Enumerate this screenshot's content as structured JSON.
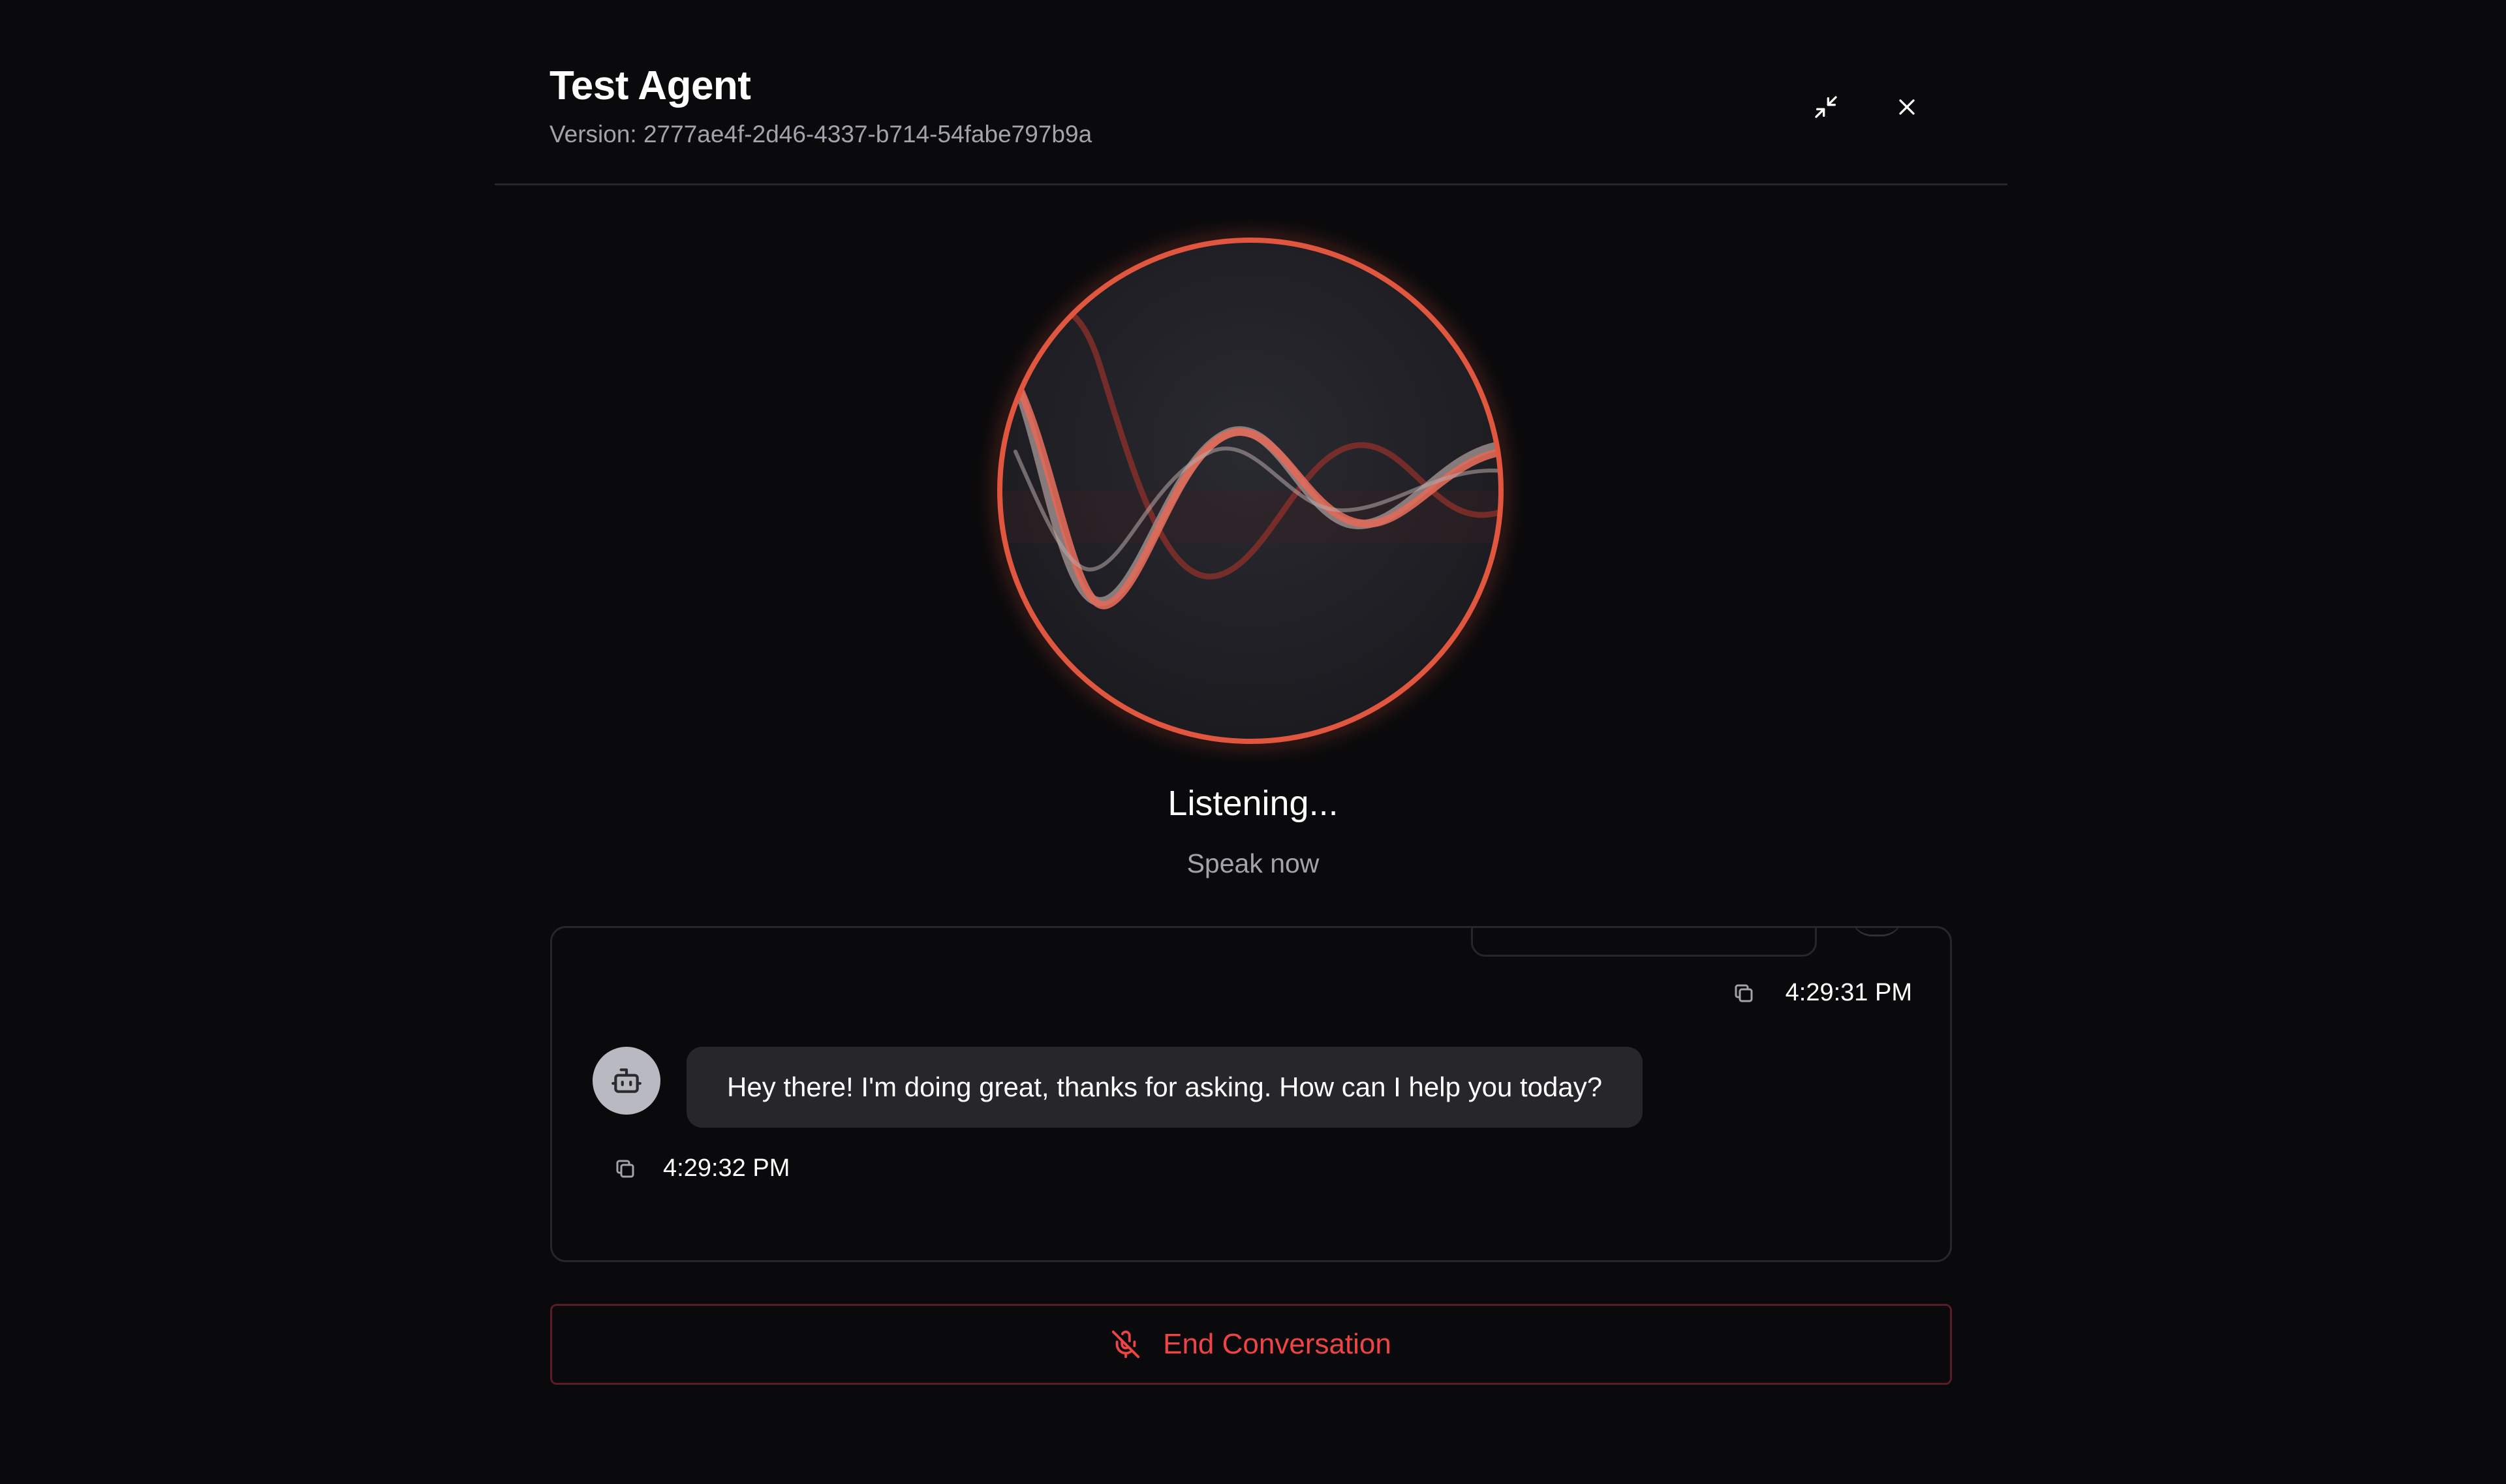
{
  "header": {
    "title": "Test Agent",
    "version": "Version: 2777ae4f-2d46-4337-b714-54fabe797b9a"
  },
  "status": {
    "title": "Listening...",
    "subtitle": "Speak now"
  },
  "transcript": {
    "user_message": {
      "time": "4:29:31 PM"
    },
    "agent_message": {
      "text": "Hey there! I'm doing great, thanks for asking. How can I help you today?",
      "time": "4:29:32 PM"
    }
  },
  "controls": {
    "end_label": "End Conversation"
  },
  "colors": {
    "accent": "#ef4444",
    "orb_ring": "#e0563f",
    "background": "#0a0a0c"
  }
}
